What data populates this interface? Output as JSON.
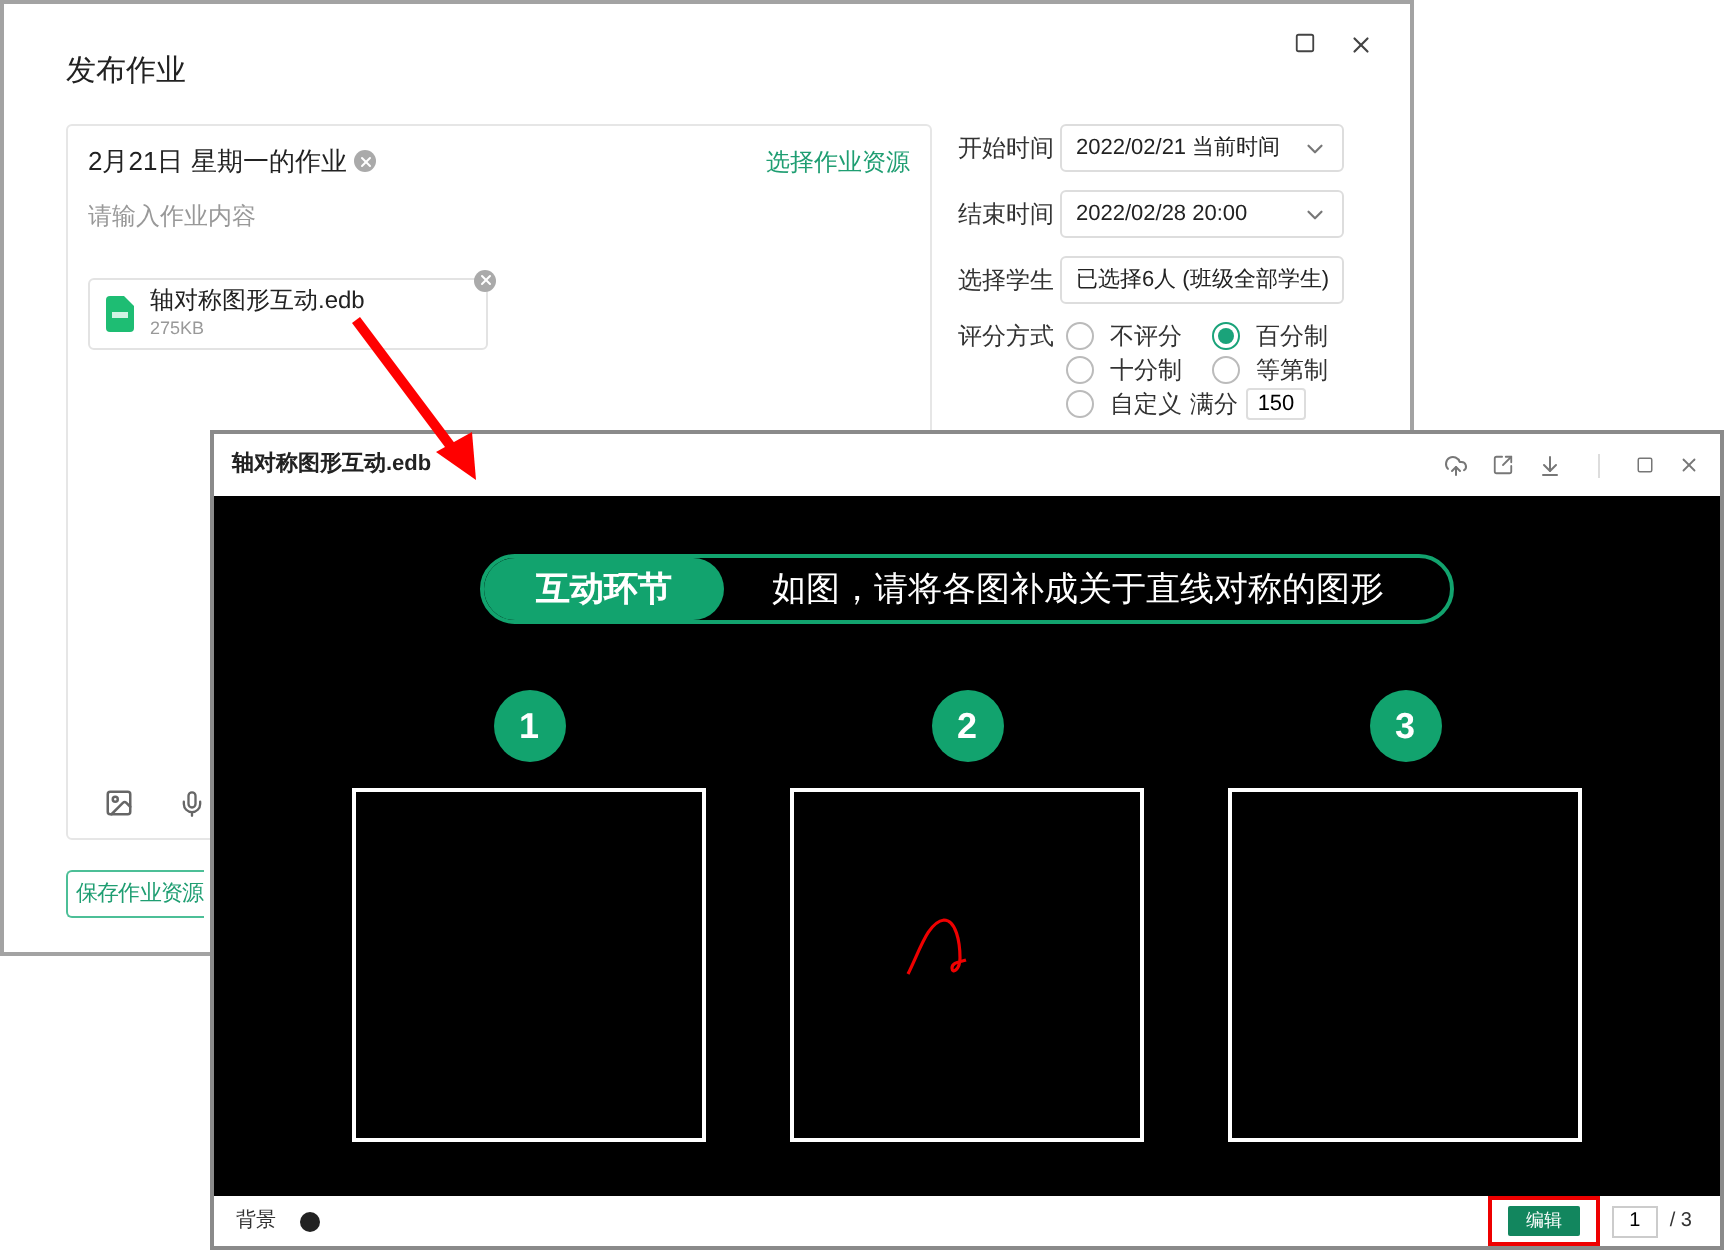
{
  "back_window": {
    "title": "发布作业",
    "assignment": {
      "title": "2月21日 星期一的作业",
      "placeholder": "请输入作业内容",
      "resource_link": "选择作业资源",
      "attachment": {
        "name": "轴对称图形互动.edb",
        "size": "275KB"
      }
    },
    "save_button": "保存作业资源",
    "fields": [
      {
        "label": "开始时间",
        "value": "2022/02/21 当前时间",
        "kind": "dropdown"
      },
      {
        "label": "结束时间",
        "value": "2022/02/28 20:00",
        "kind": "dropdown"
      },
      {
        "label": "选择学生",
        "value": "已选择6人 (班级全部学生)",
        "kind": "text"
      }
    ],
    "grading": {
      "label": "评分方式",
      "options": [
        {
          "label": "不评分",
          "selected": false
        },
        {
          "label": "百分制",
          "selected": true
        },
        {
          "label": "十分制",
          "selected": false
        },
        {
          "label": "等第制",
          "selected": false
        }
      ],
      "custom": {
        "label": "自定义",
        "selected": false,
        "full_label": "满分",
        "full_value": "150"
      }
    }
  },
  "viewer": {
    "title": "轴对称图形互动.edb",
    "banner": {
      "tag": "互动环节",
      "text": "如图，请将各图补成关于直线对称的图形"
    },
    "panels": [
      {
        "number": "1",
        "scribble": false
      },
      {
        "number": "2",
        "scribble": true
      },
      {
        "number": "3",
        "scribble": false
      }
    ],
    "footer": {
      "background_label": "背景",
      "edit_button": "编辑",
      "edit_highlighted": true,
      "page": "1",
      "total": "/ 3"
    }
  }
}
